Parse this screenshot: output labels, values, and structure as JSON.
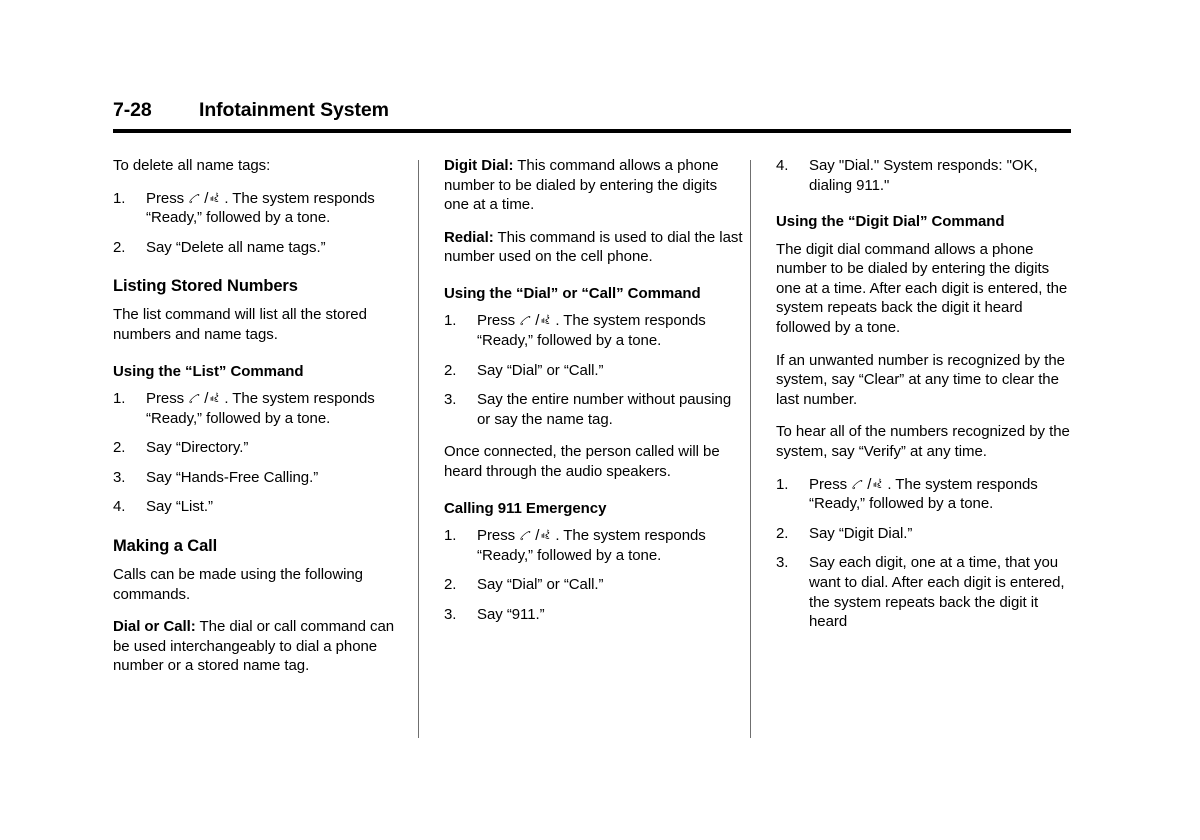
{
  "header": {
    "page_number": "7-28",
    "title": "Infotainment System"
  },
  "icons": {
    "phone_label": "phone-handset-icon",
    "talk_label": "voice-talk-icon",
    "separator": "/"
  },
  "columns": [
    {
      "id": "column-1",
      "blocks": [
        {
          "type": "paragraph",
          "text": "To delete all name tags:"
        },
        {
          "type": "steps",
          "items": [
            {
              "num": "1.",
              "pre": "Press ",
              "has_icons": true,
              "post": ". The system responds “Ready,” followed by a tone."
            },
            {
              "num": "2.",
              "pre": "Say “Delete all name tags.”",
              "has_icons": false,
              "post": ""
            }
          ]
        },
        {
          "type": "h2",
          "text": "Listing Stored Numbers"
        },
        {
          "type": "paragraph",
          "text": "The list command will list all the stored numbers and name tags."
        },
        {
          "type": "h3",
          "text": "Using the “List” Command"
        },
        {
          "type": "steps",
          "items": [
            {
              "num": "1.",
              "pre": "Press ",
              "has_icons": true,
              "post": ". The system responds “Ready,” followed by a tone."
            },
            {
              "num": "2.",
              "pre": "Say “Directory.”",
              "has_icons": false,
              "post": ""
            },
            {
              "num": "3.",
              "pre": "Say “Hands-Free Calling.”",
              "has_icons": false,
              "post": ""
            },
            {
              "num": "4.",
              "pre": "Say “List.”",
              "has_icons": false,
              "post": ""
            }
          ]
        },
        {
          "type": "h2",
          "text": "Making a Call"
        },
        {
          "type": "paragraph",
          "text": "Calls can be made using the following commands."
        },
        {
          "type": "paragraph",
          "lead": "Dial or Call:",
          "text": "  The dial or call command can be used interchangeably to dial a phone number or a stored name tag."
        }
      ]
    },
    {
      "id": "column-2",
      "blocks": [
        {
          "type": "paragraph",
          "lead": "Digit Dial:",
          "text": "  This command allows a phone number to be dialed by entering the digits one at a time."
        },
        {
          "type": "paragraph",
          "lead": "Redial:",
          "text": "  This command is used to dial the last number used on the cell phone."
        },
        {
          "type": "h3",
          "text": "Using the “Dial” or “Call” Command"
        },
        {
          "type": "steps",
          "items": [
            {
              "num": "1.",
              "pre": "Press ",
              "has_icons": true,
              "post": ". The system responds “Ready,” followed by a tone."
            },
            {
              "num": "2.",
              "pre": "Say “Dial” or “Call.”",
              "has_icons": false,
              "post": ""
            },
            {
              "num": "3.",
              "pre": "Say the entire number without pausing or say the name tag.",
              "has_icons": false,
              "post": ""
            }
          ]
        },
        {
          "type": "paragraph",
          "text": "Once connected, the person called will be heard through the audio speakers."
        },
        {
          "type": "h3",
          "text": "Calling 911 Emergency"
        },
        {
          "type": "steps",
          "items": [
            {
              "num": "1.",
              "pre": "Press ",
              "has_icons": true,
              "post": ". The system responds “Ready,” followed by a tone."
            },
            {
              "num": "2.",
              "pre": "Say “Dial” or “Call.”",
              "has_icons": false,
              "post": ""
            },
            {
              "num": "3.",
              "pre": "Say “911.”",
              "has_icons": false,
              "post": ""
            }
          ]
        }
      ]
    },
    {
      "id": "column-3",
      "blocks": [
        {
          "type": "steps",
          "items": [
            {
              "num": "4.",
              "pre": "Say \"Dial.\" System responds: \"OK, dialing 911.\"",
              "has_icons": false,
              "post": ""
            }
          ]
        },
        {
          "type": "h3",
          "text": "Using the “Digit Dial” Command"
        },
        {
          "type": "paragraph",
          "text": "The digit dial command allows a phone number to be dialed by entering the digits one at a time. After each digit is entered, the system repeats back the digit it heard followed by a tone."
        },
        {
          "type": "paragraph",
          "text": "If an unwanted number is recognized by the system, say “Clear” at any time to clear the last number."
        },
        {
          "type": "paragraph",
          "text": "To hear all of the numbers recognized by the system, say “Verify” at any time."
        },
        {
          "type": "steps",
          "items": [
            {
              "num": "1.",
              "pre": "Press ",
              "has_icons": true,
              "post": ". The system responds “Ready,” followed by a tone."
            },
            {
              "num": "2.",
              "pre": "Say “Digit Dial.”",
              "has_icons": false,
              "post": ""
            },
            {
              "num": "3.",
              "pre": "Say each digit, one at a time, that you want to dial. After each digit is entered, the system repeats back the digit it heard",
              "has_icons": false,
              "post": ""
            }
          ]
        }
      ]
    }
  ]
}
